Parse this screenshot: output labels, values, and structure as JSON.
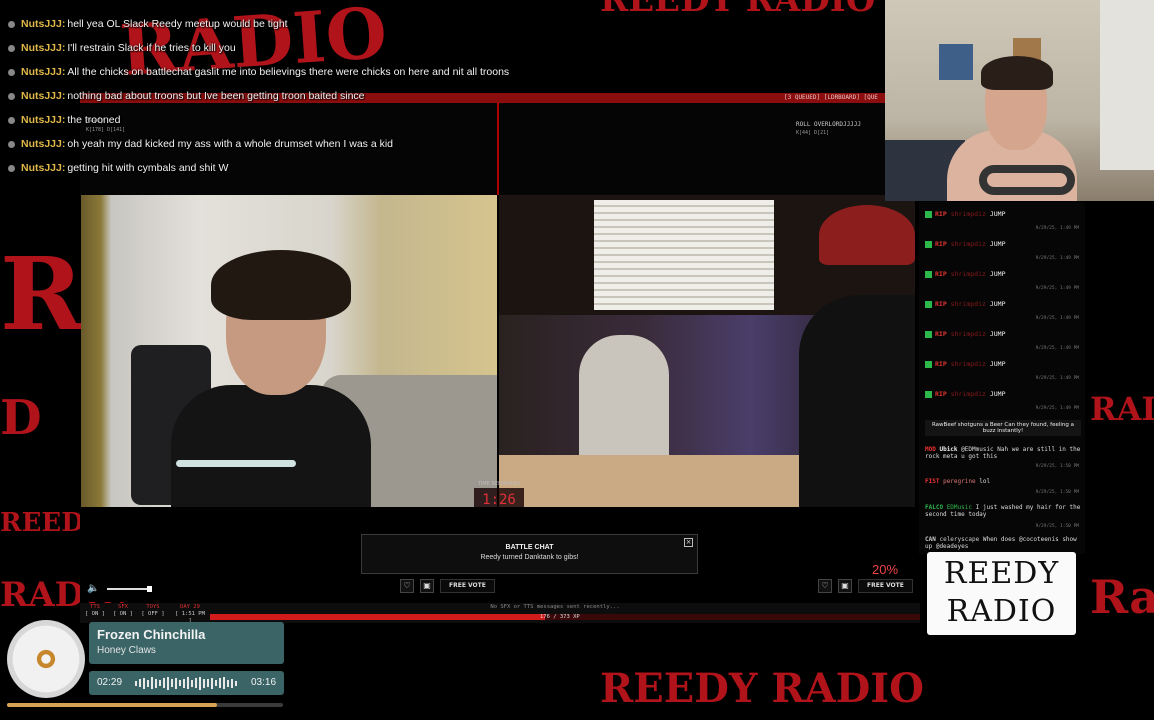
{
  "chat_overlay": [
    {
      "user": "NutsJJJ:",
      "text": "hell yea OL Slack Reedy meetup would be tight"
    },
    {
      "user": "NutsJJJ:",
      "text": "I'll restrain Slack if he tries to kill you"
    },
    {
      "user": "NutsJJJ:",
      "text": "All the chicks on battlechat gaslit me into believings there were chicks on here and nit all troons"
    },
    {
      "user": "NutsJJJ:",
      "text": "nothing bad about troons but Ive been getting troon baited since"
    },
    {
      "user": "NutsJJJ:",
      "text": "the trooned"
    },
    {
      "user": "NutsJJJ:",
      "text": "oh yeah my dad kicked my ass with a whole drumset when I was a kid"
    },
    {
      "user": "NutsJJJ:",
      "text": "getting hit with cymbals and shit W"
    }
  ],
  "stream": {
    "queue_label": "[3 QUEUED] [LDRBOARD] [QUE",
    "left_tag": "Reedy",
    "left_stats": "K[178] D[141]",
    "right_tag": "ROLL OVERLORDJJJJJ",
    "right_stats": "K[44] D[21]",
    "timer_label": "TIME REMAINING",
    "timer": "1:26"
  },
  "battle_chat": {
    "title": "BATTLE CHAT",
    "message": "Reedy turned Danktank to gibs!",
    "close": "×"
  },
  "vote": {
    "percent": "20%",
    "free_vote_label": "FREE VOTE"
  },
  "status": {
    "tts_label": "TTS",
    "tts_value": "[ ON ]",
    "sfx_label": "SFX",
    "sfx_value": "[ ON ]",
    "toys_label": "TOYS",
    "toys_value": "[ OFF ]",
    "day_label": "DAY 29",
    "day_value": "[ 1:51 PM ]",
    "no_sfx_text": "No SFX or TTS messages sent recently...",
    "xp_text": "176 / 373 XP",
    "xp_current": 176,
    "xp_total": 373
  },
  "side_chat": {
    "badge": "RIP",
    "entries": [
      {
        "user": "shrimpdiz",
        "msg": "JUMP",
        "time": "9/29/25, 1:49 PM"
      },
      {
        "user": "shrimpdiz",
        "msg": "JUMP",
        "time": "9/29/25, 1:49 PM"
      },
      {
        "user": "shrimpdiz",
        "msg": "JUMP",
        "time": "9/29/25, 1:49 PM"
      },
      {
        "user": "shrimpdiz",
        "msg": "JUMP",
        "time": "9/29/25, 1:49 PM"
      },
      {
        "user": "shrimpdiz",
        "msg": "JUMP",
        "time": "9/29/25, 1:49 PM"
      },
      {
        "user": "shrimpdiz",
        "msg": "JUMP",
        "time": "9/29/25, 1:49 PM"
      },
      {
        "user": "shrimpdiz",
        "msg": "JUMP",
        "time": "9/29/25, 1:49 PM"
      }
    ],
    "event": "RawBeef shotguns a Beer Can they found, feeling a buzz instantly!",
    "messages": [
      {
        "badge": "MOD",
        "user": "Ubick",
        "text": "@EDMmusic Nah we are still in the rock meta u got this",
        "time": "9/29/25, 1:50 PM"
      },
      {
        "badge": "FIST",
        "user": "peregrine",
        "text": "lol",
        "time": "9/29/25, 1:50 PM"
      },
      {
        "badge": "FALCO",
        "user": "EDMusic",
        "text": "I just washed my hair for the second time today",
        "time": "9/29/25, 1:50 PM"
      },
      {
        "badge": "CAN",
        "user": "celeryscape",
        "text": "When does @cocoteenis show up @deadeyes",
        "time": ""
      }
    ]
  },
  "logo": {
    "line1": "REEDY",
    "line2": "RADIO"
  },
  "now_playing": {
    "title": "Frozen Chinchilla",
    "artist": "Honey Claws",
    "elapsed": "02:29",
    "duration": "03:16",
    "progress": 0.76
  },
  "background_text": {
    "words": [
      "REEDY RADIO",
      "RADIO",
      "Ri",
      "D",
      "REEDY",
      "RADIC",
      "RADIO",
      "Ra",
      "REEDY RADIO"
    ]
  }
}
